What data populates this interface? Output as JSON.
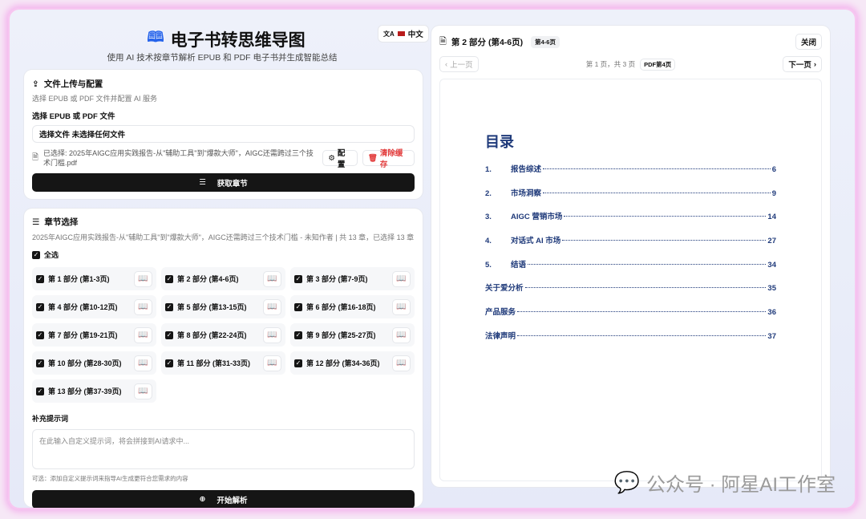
{
  "header": {
    "title": "电子书转思维导图",
    "subtitle": "使用 AI 技术按章节解析 EPUB 和 PDF 电子书并生成智能总结",
    "lang": "中文"
  },
  "upload": {
    "title": "文件上传与配置",
    "desc": "选择 EPUB 或 PDF 文件并配置 AI 服务",
    "file_label": "选择 EPUB 或 PDF 文件",
    "file_input": "选择文件 未选择任何文件",
    "selected": "已选择: 2025年AIGC应用实践报告-从\"辅助工具\"到\"爆款大师\"，AIGC还需跨过三个技术门槛.pdf",
    "config": "配置",
    "clear": "清除缓存",
    "fetch": "获取章节"
  },
  "chapters": {
    "title": "章节选择",
    "summary": "2025年AIGC应用实践报告-从\"辅助工具\"到\"爆款大师\"，AIGC还需跨过三个技术门槛 - 未知作者 | 共 13 章，已选择 13 章",
    "select_all": "全选",
    "items": [
      "第 1 部分 (第1-3页)",
      "第 2 部分 (第4-6页)",
      "第 3 部分 (第7-9页)",
      "第 4 部分 (第10-12页)",
      "第 5 部分 (第13-15页)",
      "第 6 部分 (第16-18页)",
      "第 7 部分 (第19-21页)",
      "第 8 部分 (第22-24页)",
      "第 9 部分 (第25-27页)",
      "第 10 部分 (第28-30页)",
      "第 11 部分 (第31-33页)",
      "第 12 部分 (第34-36页)",
      "第 13 部分 (第37-39页)"
    ],
    "prompt_label": "补充提示词",
    "prompt_placeholder": "在此输入自定义提示词，将会拼接到AI请求中...",
    "prompt_hint": "可选：添加自定义提示词来指导AI生成更符合您需求的内容",
    "start": "开始解析"
  },
  "viewer": {
    "title": "第 2 部分 (第4-6页)",
    "badge": "第4-6页",
    "close": "关闭",
    "prev": "上一页",
    "next": "下一页",
    "page_info": "第 1 页，共 3 页",
    "pdf_page": "PDF第4页",
    "toc_title": "目录",
    "toc": [
      {
        "num": "1.",
        "label": "报告综述",
        "page": "6"
      },
      {
        "num": "2.",
        "label": "市场洞察",
        "page": "9"
      },
      {
        "num": "3.",
        "label": "AIGC 营销市场",
        "page": "14"
      },
      {
        "num": "4.",
        "label": "对话式 AI 市场",
        "page": "27"
      },
      {
        "num": "5.",
        "label": "结语",
        "page": "34"
      },
      {
        "num": "",
        "label": "关于爱分析",
        "page": "35"
      },
      {
        "num": "",
        "label": "产品服务",
        "page": "36"
      },
      {
        "num": "",
        "label": "法律声明",
        "page": "37"
      }
    ]
  },
  "watermark": "公众号 · 阿星AI工作室"
}
